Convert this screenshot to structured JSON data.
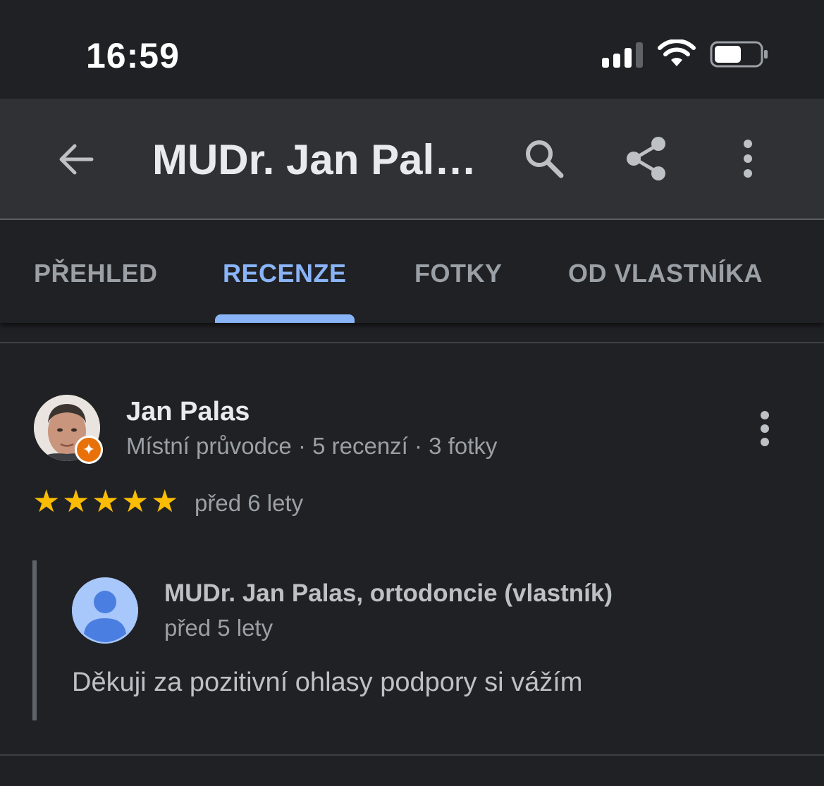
{
  "status_bar": {
    "time": "16:59",
    "icons": [
      "cellular-signal-icon",
      "wifi-icon",
      "battery-icon"
    ]
  },
  "app_bar": {
    "title": "MUDr. Jan Pal…",
    "icons": [
      "back-arrow-icon",
      "search-icon",
      "share-icon",
      "more-vertical-icon"
    ]
  },
  "tabs": [
    {
      "label": "PŘEHLED",
      "active": false
    },
    {
      "label": "RECENZE",
      "active": true
    },
    {
      "label": "FOTKY",
      "active": false
    },
    {
      "label": "OD VLASTNÍKA",
      "active": false
    }
  ],
  "review": {
    "author": "Jan Palas",
    "meta": "Místní průvodce · 5 recenzí · 3 fotky",
    "rating": 5,
    "rating_max": 5,
    "date": "před 6 lety"
  },
  "owner_reply": {
    "name": "MUDr. Jan Palas, ortodoncie (vlastník)",
    "date": "před 5 lety",
    "text": "Děkuji za pozitivní ohlasy podpory si vážím"
  },
  "colors": {
    "background": "#202124",
    "app_bar": "#303134",
    "accent": "#8ab4f8",
    "star": "#fbbc04",
    "local_guide_badge": "#e8710a",
    "secondary_text": "#9aa0a6"
  }
}
